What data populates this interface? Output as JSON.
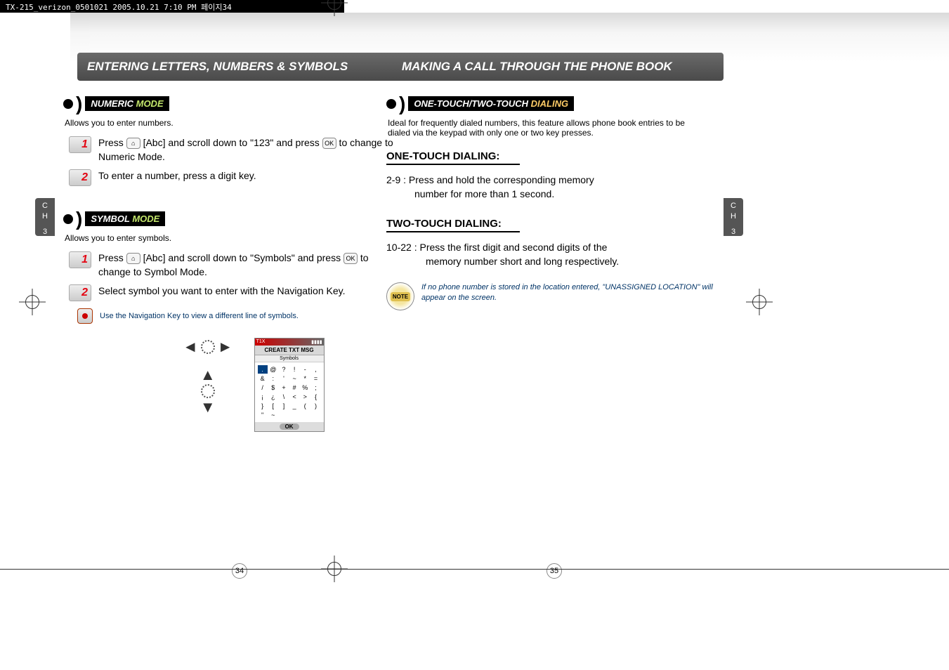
{
  "header": {
    "file_stamp": "TX-215_verizon_0501021 2005.10.21 7:10 PM 페이지34"
  },
  "chapter_tab": {
    "letters": "C\nH",
    "num": "3"
  },
  "left": {
    "title": "ENTERING LETTERS, NUMBERS & SYMBOLS",
    "numeric": {
      "label_pre": "NUMERIC ",
      "label_em": "MODE",
      "intro": "Allows you to enter numbers.",
      "step1": "Press       [Abc] and scroll down to \"123\" and press       to change to Numeric Mode.",
      "step2": "To enter a number, press a digit key."
    },
    "symbol": {
      "label_pre": "SYMBOL ",
      "label_em": "MODE",
      "intro": "Allows you to enter symbols.",
      "step1": "Press       [Abc] and scroll down to \"Symbols\" and press       to change to Symbol Mode.",
      "step2": "Select symbol you want to enter with the Navigation Key.",
      "tip": "Use the Navigation Key to view a different line of symbols."
    },
    "phone": {
      "status": "T1X",
      "title": "CREATE TXT MSG",
      "sub": "Symbols",
      "ok": "OK"
    },
    "chart_data": {
      "type": "table",
      "title": "Symbols",
      "grid": [
        [
          ".",
          "@",
          "?",
          "!",
          "-",
          ","
        ],
        [
          "&",
          ":",
          "'",
          "~",
          "*",
          "="
        ],
        [
          "/",
          "$",
          "+",
          "#",
          "%",
          ";"
        ],
        [
          "¡",
          "¿",
          "\\",
          "<",
          ">",
          "{"
        ],
        [
          "}",
          "[",
          "]",
          "_",
          "(",
          ")"
        ],
        [
          "\"",
          "~",
          "",
          "",
          "",
          ""
        ]
      ]
    },
    "page_num": "34"
  },
  "right": {
    "title": "MAKING A CALL THROUGH THE PHONE BOOK",
    "dialing": {
      "label_pre": "ONE-TOUCH/TWO-TOUCH ",
      "label_em": "DIALING",
      "intro": "Ideal for frequently dialed numbers, this feature allows phone book entries to be dialed via the keypad with only one or two key presses.",
      "one_heading": "ONE-TOUCH DIALING:",
      "one_text_a": "2-9 : Press and hold the corresponding memory",
      "one_text_b": "number for more than 1 second.",
      "two_heading": "TWO-TOUCH DIALING:",
      "two_text_a": "10-22 : Press the first digit and second digits of the",
      "two_text_b": "memory number short and long respectively.",
      "note_badge": "NOTE",
      "note": "If no phone number is stored in the location entered, \"UNASSIGNED LOCATION\" will appear on the screen."
    },
    "page_num": "35"
  }
}
